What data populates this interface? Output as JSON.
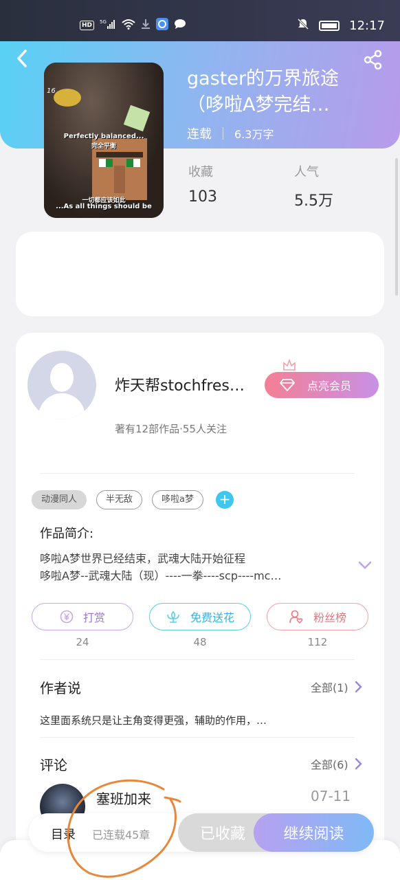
{
  "status_bar": {
    "left_indicators": [
      "HD",
      "5G",
      "signal",
      "wifi",
      "download",
      "app",
      "chat"
    ],
    "time": "12:17"
  },
  "book": {
    "title_line1": "gaster的万界旅途",
    "title_line2": "（哆啦A梦完结…",
    "status": "连载",
    "word_count": "6.3万字",
    "favorites_label": "收藏",
    "favorites_value": "103",
    "popularity_label": "人气",
    "popularity_value": "5.5万",
    "cover_captions": {
      "num": "16",
      "line1": "Perfectly balanced...",
      "line2": "完全平衡",
      "line3": "一切都应该如此",
      "line4": "...As all things should be"
    }
  },
  "author": {
    "name": "炸天帮stochfres…",
    "sub": "著有12部作品·55人关注",
    "vip_label": "点亮会员"
  },
  "tags": [
    "动漫同人",
    "半无敌",
    "哆啦a梦"
  ],
  "intro": {
    "title": "作品简介:",
    "line1": "哆啦A梦世界已经结束，武魂大陆开始征程",
    "line2": "哆啦A梦--武魂大陆（现）----一拳----scp----mc…"
  },
  "actions": [
    {
      "label": "打赏",
      "count": "24"
    },
    {
      "label": "免费送花",
      "count": "48"
    },
    {
      "label": "粉丝榜",
      "count": "112"
    }
  ],
  "author_says": {
    "title": "作者说",
    "more": "全部(1)",
    "text": "这里面系统只是让主角变得更强，辅助的作用，…"
  },
  "comments": {
    "title": "评论",
    "more": "全部(6)",
    "first_name": "塞班加来",
    "first_date": "07-11"
  },
  "bottom_bar": {
    "toc": "目录",
    "toc_sub": "已连载45章",
    "favorited": "已收藏",
    "continue": "继续阅读"
  },
  "colors": {
    "header_gradient": [
      "#56d2f5",
      "#b79bea"
    ],
    "accent_cyan": "#3ec8f0",
    "annotation": "#e8873a"
  }
}
